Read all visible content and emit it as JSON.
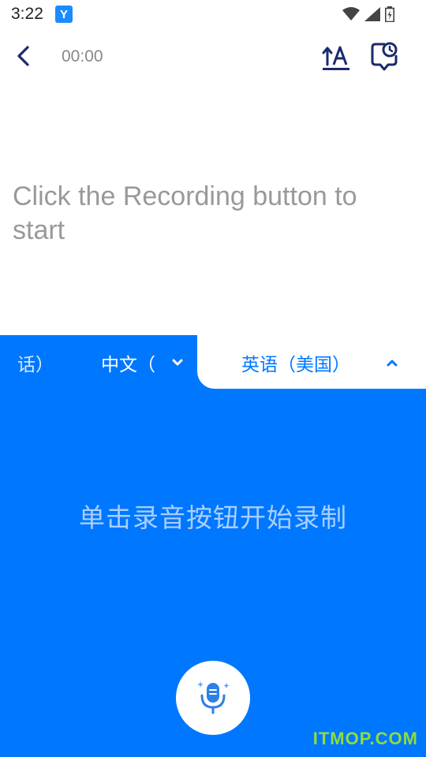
{
  "status_bar": {
    "time": "3:22",
    "app_badge": "Y"
  },
  "toolbar": {
    "timer": "00:00"
  },
  "main": {
    "hint": "Click the Recording button to start"
  },
  "language_bar": {
    "previous_language_fragment": "话）",
    "source_language": "中文（",
    "target_language": "英语（美国）"
  },
  "panel": {
    "hint": "单击录音按钮开始录制"
  },
  "watermark": "ITMOP.COM",
  "colors": {
    "accent": "#0077ff",
    "primary_text": "#222222",
    "muted_text": "#999999",
    "panel_hint": "#a9cfff",
    "dark_icon": "#1a2a6c"
  }
}
